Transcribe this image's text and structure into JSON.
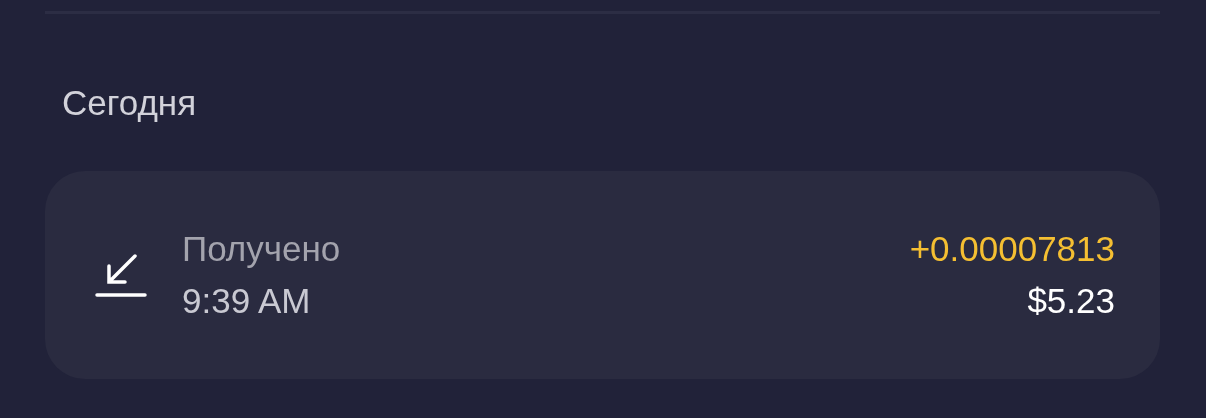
{
  "section_title": "Сегодня",
  "transactions": [
    {
      "kind": "received",
      "label": "Получено",
      "time": "9:39 AM",
      "amount": "+0.00007813",
      "fiat": "$5.23"
    }
  ]
}
